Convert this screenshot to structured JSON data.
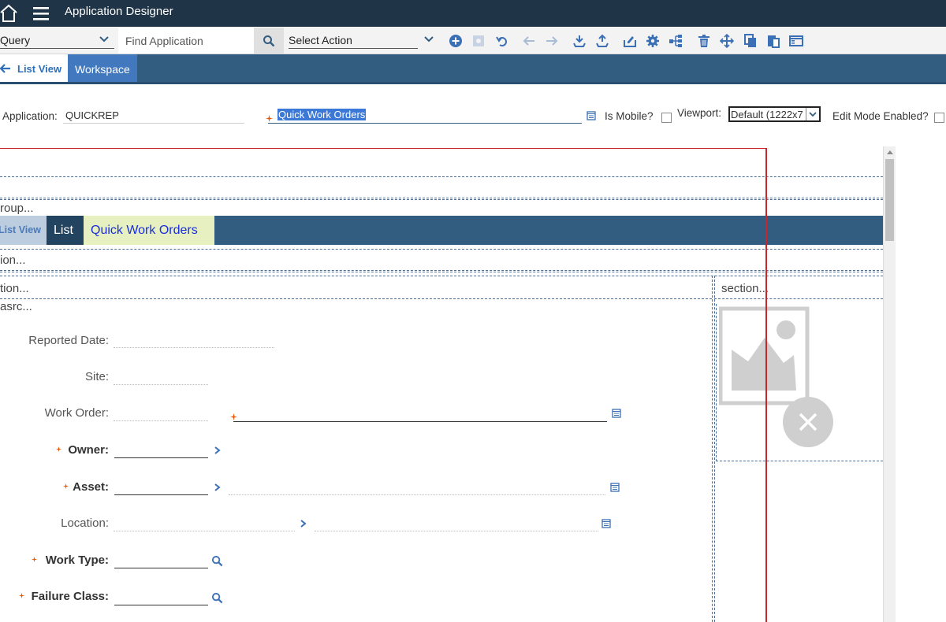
{
  "app": {
    "title": "Application Designer"
  },
  "toolbar": {
    "query_label": "Query",
    "find_placeholder": "Find Application",
    "action_label": "Select Action"
  },
  "tabs": [
    {
      "label": "List View"
    },
    {
      "label": "Workspace"
    }
  ],
  "header": {
    "application_label": "Application:",
    "application_value": "QUICKREP",
    "description_value": "Quick Work Orders",
    "is_mobile_label": "Is Mobile?",
    "viewport_label": "Viewport:",
    "viewport_value": "Default (1222x7",
    "edit_mode_label": "Edit Mode Enabled?"
  },
  "canvas": {
    "group_text": "roup...",
    "inner_tabs": [
      "List View",
      "List",
      "Quick Work Orders"
    ],
    "section_text_1": "ion...",
    "section_text_2": "tion...",
    "section_text_3": "section...",
    "datasrc_text": "asrc...",
    "fields": {
      "reported_date": "Reported Date:",
      "site": "Site:",
      "work_order": "Work Order:",
      "owner": "Owner:",
      "asset": "Asset:",
      "location": "Location:",
      "work_type": "Work Type:",
      "failure_class": "Failure Class:"
    }
  },
  "colors": {
    "topbar": "#1f3447",
    "tabsbar": "#325c80",
    "accent": "#4178be",
    "required": "#e8590c",
    "guide_line": "#c9252b"
  }
}
